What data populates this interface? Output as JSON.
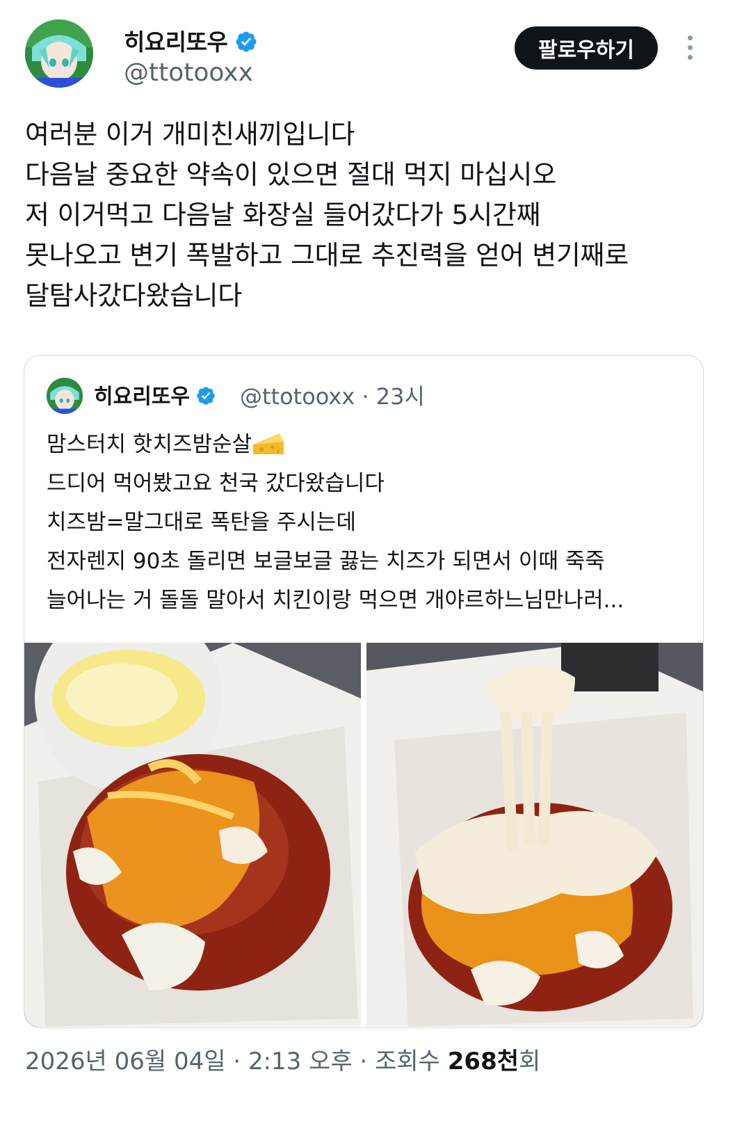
{
  "author": {
    "display_name": "히요리또우",
    "handle": "@ttotooxx",
    "verified": true
  },
  "actions": {
    "follow_label": "팔로우하기",
    "more_icon": "more-vertical-icon"
  },
  "tweet": {
    "lines": [
      "여러분 이거 개미친새끼입니다",
      "다음날 중요한 약속이 있으면 절대 먹지 마십시오",
      "저 이거먹고 다음날 화장실 들어갔다가 5시간째",
      "못나오고 변기 폭발하고 그대로 추진력을 얻어 변기째로",
      "달탐사갔다왔습니다"
    ]
  },
  "quote": {
    "display_name": "히요리또우",
    "handle": "@ttotooxx",
    "time": "23시",
    "separator": " · ",
    "lines": [
      "맘스터치 핫치즈밤순살",
      "드디어 먹어봤고요 천국 갔다왔습니다",
      "치즈밤=말그대로 폭탄을 주시는데",
      "전자렌지 90초 돌리면 보글보글 끓는 치즈가 되면서 이때 죽죽",
      "늘어나는 거 돌돌 말아서 치킨이랑 먹으면 개야르하느님만나러..."
    ],
    "emoji_icon": "cheese-wedge-icon"
  },
  "footer": {
    "date": "2026년 06월 04일",
    "time": "2:13 오후",
    "views_label": "조회수",
    "views_count": "268천",
    "views_suffix": "회",
    "sep": " · "
  },
  "colors": {
    "follow_bg": "#0f1419",
    "verified_blue": "#1d9bf0",
    "secondary_text": "#536471",
    "border": "#cfd9de"
  }
}
